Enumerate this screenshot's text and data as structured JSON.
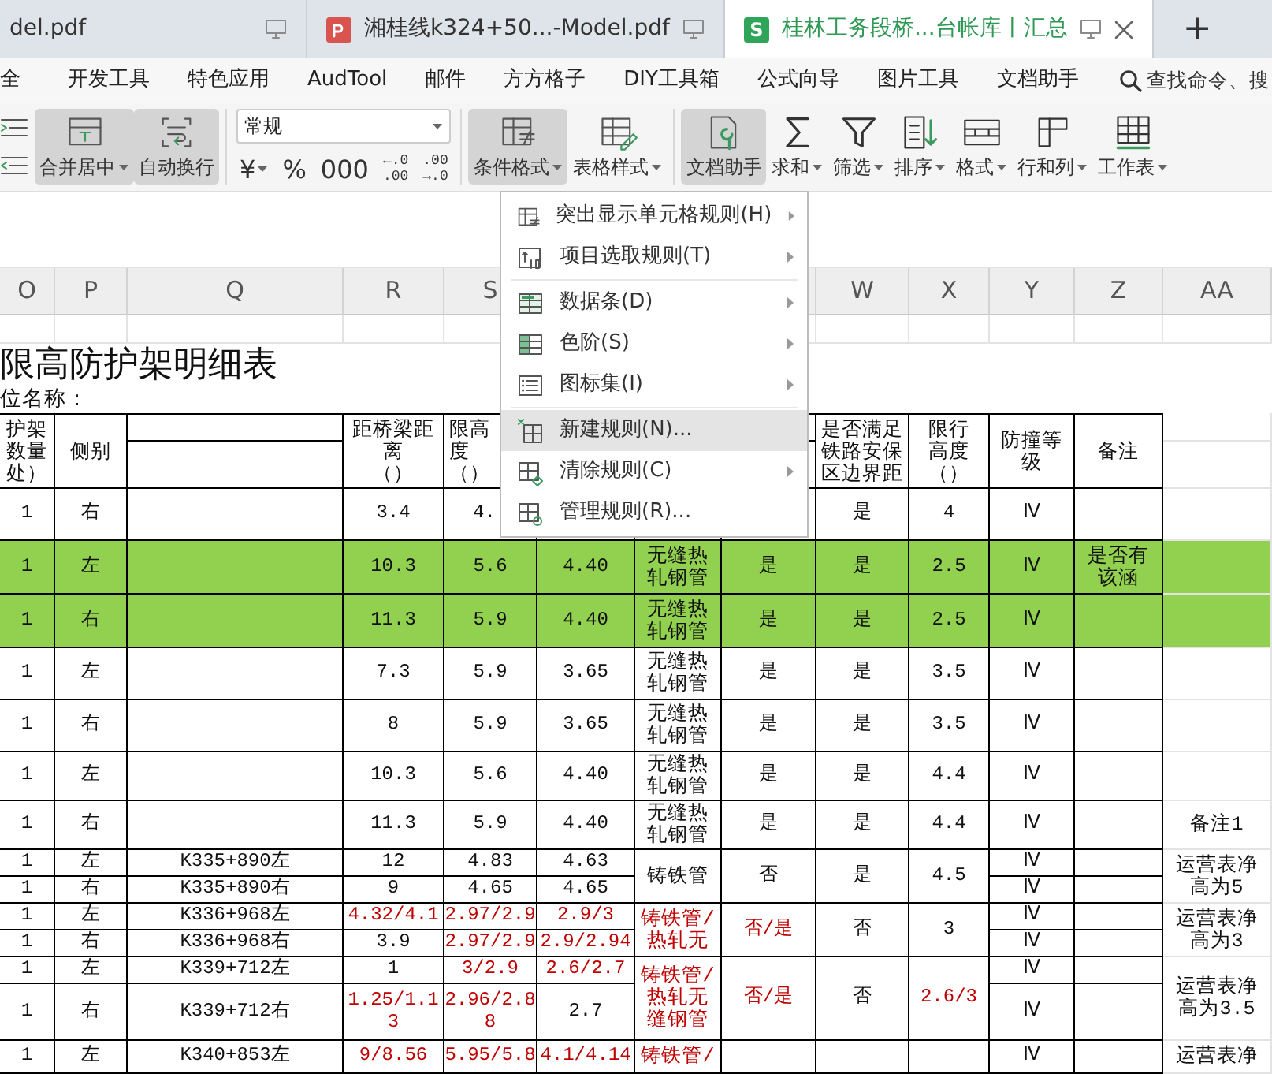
{
  "tabs": [
    {
      "label": "del.pdf",
      "kind": "plain",
      "selected": false
    },
    {
      "label": "湘桂线k324+50...-Model.pdf",
      "kind": "pdf",
      "selected": false
    },
    {
      "label": "桂林工务段桥...台帐库丨汇总",
      "kind": "sheet",
      "logo": "S",
      "selected": true
    }
  ],
  "new_tab": "+",
  "menu_tabs": [
    "全",
    "开发工具",
    "特色应用",
    "AudTool",
    "邮件",
    "方方格子",
    "DIY工具箱",
    "公式向导",
    "图片工具",
    "文档助手"
  ],
  "search": {
    "placeholder": "查找命令、搜"
  },
  "ribbon": [
    {
      "kind": "icon-stack"
    },
    {
      "kind": "big",
      "label": "合并居中",
      "dropdown": true,
      "pressed": true
    },
    {
      "kind": "big",
      "label": "自动换行",
      "dropdown": false,
      "pressed": true
    },
    {
      "kind": "separator"
    },
    {
      "kind": "number-format",
      "value": "常规",
      "symbols": [
        {
          "lines": [
            "¥"
          ],
          "dropdown": true
        },
        {
          "lines": [
            "%"
          ],
          "dropdown": false
        },
        {
          "lines": [
            "000"
          ],
          "dropdown": false
        },
        {
          "lines": [
            "←.0",
            ".00"
          ],
          "dropdown": false
        },
        {
          "lines": [
            ".00",
            "→.0"
          ],
          "dropdown": false
        }
      ]
    },
    {
      "kind": "separator"
    },
    {
      "kind": "big",
      "label": "条件格式",
      "dropdown": true,
      "pressed": true
    },
    {
      "kind": "big",
      "label": "表格样式",
      "dropdown": true,
      "pressed": false
    },
    {
      "kind": "separator"
    },
    {
      "kind": "big",
      "label": "文档助手",
      "dropdown": false,
      "pressed": true
    },
    {
      "kind": "big",
      "label": "求和",
      "dropdown": true,
      "pressed": false
    },
    {
      "kind": "big",
      "label": "筛选",
      "dropdown": true,
      "pressed": false
    },
    {
      "kind": "big",
      "label": "排序",
      "dropdown": true,
      "pressed": false
    },
    {
      "kind": "big",
      "label": "格式",
      "dropdown": true,
      "pressed": false
    },
    {
      "kind": "big",
      "label": "行和列",
      "dropdown": true,
      "pressed": false
    },
    {
      "kind": "big",
      "label": "工作表",
      "dropdown": true,
      "pressed": false
    }
  ],
  "menu": {
    "groups": [
      [
        {
          "label": "突出显示单元格规则(H)",
          "submenu": true,
          "highlighted": false
        },
        {
          "label": "项目选取规则(T)",
          "submenu": true,
          "highlighted": false
        }
      ],
      [
        {
          "label": "数据条(D)",
          "submenu": true,
          "highlighted": false
        },
        {
          "label": "色阶(S)",
          "submenu": true,
          "highlighted": false
        },
        {
          "label": "图标集(I)",
          "submenu": true,
          "highlighted": false
        }
      ],
      [
        {
          "label": "新建规则(N)...",
          "submenu": false,
          "highlighted": true
        },
        {
          "label": "清除规则(C)",
          "submenu": true,
          "highlighted": false
        },
        {
          "label": "管理规则(R)...",
          "submenu": false,
          "highlighted": false
        }
      ]
    ]
  },
  "sheet": {
    "columns": [
      {
        "label": "O"
      },
      {
        "label": "P"
      },
      {
        "label": "Q"
      },
      {
        "label": "R"
      },
      {
        "label": "S"
      },
      {},
      {},
      {},
      {
        "label": "W"
      },
      {
        "label": "X"
      },
      {
        "label": "Y"
      },
      {
        "label": "Z"
      },
      {
        "label": "AA"
      }
    ],
    "rows": [
      {
        "kind": "blank"
      },
      {
        "kind": "title",
        "cells": [
          {
            "text": "限高防护架明细表"
          }
        ]
      },
      {
        "kind": "label",
        "cells": [
          {
            "text": "位名称："
          }
        ]
      },
      {
        "kind": "header",
        "cells": [
          {
            "lines": [
              "护架",
              "数量",
              "处）"
            ],
            "tall": true
          },
          {
            "lines": [
              "侧别"
            ],
            "tall": true
          },
          {},
          {
            "lines": [
              "距桥梁距",
              "离",
              "（）"
            ],
            "tall": true
          },
          {
            "lines": [
              "限高",
              "度",
              "（）"
            ],
            "tall": true
          },
          {},
          {},
          {},
          {
            "lines": [
              "是否满足",
              "铁路安保",
              "区边界距"
            ],
            "tall": true
          },
          {
            "lines": [
              "限行",
              "高度",
              "（）"
            ],
            "tall": true
          },
          {
            "lines": [
              "防撞等",
              "级"
            ],
            "tall": true
          },
          {
            "lines": [
              "备注"
            ],
            "tall": true
          }
        ]
      },
      {
        "kind": "header"
      },
      {
        "kind": "table",
        "highlight": false,
        "cells": [
          {
            "text": "1"
          },
          {
            "text": "右"
          },
          {},
          {
            "text": "3.4"
          },
          {
            "text": "4."
          },
          {},
          {},
          {},
          {
            "text": "是"
          },
          {
            "text": "4"
          },
          {
            "text": "Ⅳ"
          }
        ]
      },
      {
        "kind": "table",
        "highlight": true,
        "cells": [
          {
            "text": "1"
          },
          {
            "text": "左"
          },
          {},
          {
            "text": "10.3"
          },
          {
            "text": "5.6"
          },
          {
            "text": "4.40"
          },
          {
            "lines": [
              "无缝热",
              "轧钢管"
            ]
          },
          {
            "text": "是"
          },
          {
            "text": "是"
          },
          {
            "text": "2.5"
          },
          {
            "text": "Ⅳ"
          },
          {
            "text": "是否有该涵"
          }
        ]
      },
      {
        "kind": "table",
        "highlight": true,
        "cells": [
          {
            "text": "1"
          },
          {
            "text": "右"
          },
          {},
          {
            "text": "11.3"
          },
          {
            "text": "5.9"
          },
          {
            "text": "4.40"
          },
          {
            "lines": [
              "无缝热",
              "轧钢管"
            ]
          },
          {
            "text": "是"
          },
          {
            "text": "是"
          },
          {
            "text": "2.5"
          },
          {
            "text": "Ⅳ"
          }
        ]
      },
      {
        "kind": "table",
        "highlight": false,
        "cells": [
          {
            "text": "1"
          },
          {
            "text": "左"
          },
          {},
          {
            "text": "7.3"
          },
          {
            "text": "5.9"
          },
          {
            "text": "3.65"
          },
          {
            "lines": [
              "无缝热",
              "轧钢管"
            ]
          },
          {
            "text": "是"
          },
          {
            "text": "是"
          },
          {
            "text": "3.5"
          },
          {
            "text": "Ⅳ"
          }
        ]
      },
      {
        "kind": "table",
        "highlight": false,
        "cells": [
          {
            "text": "1"
          },
          {
            "text": "右"
          },
          {},
          {
            "text": "8"
          },
          {
            "text": "5.9"
          },
          {
            "text": "3.65"
          },
          {
            "lines": [
              "无缝热",
              "轧钢管"
            ]
          },
          {
            "text": "是"
          },
          {
            "text": "是"
          },
          {
            "text": "3.5"
          },
          {
            "text": "Ⅳ"
          }
        ]
      },
      {
        "kind": "table",
        "highlight": false,
        "cells": [
          {
            "text": "1"
          },
          {
            "text": "左"
          },
          {},
          {
            "text": "10.3"
          },
          {
            "text": "5.6"
          },
          {
            "text": "4.40"
          },
          {
            "lines": [
              "无缝热",
              "轧钢管"
            ]
          },
          {
            "text": "是"
          },
          {
            "text": "是"
          },
          {
            "text": "4.4"
          },
          {
            "text": "Ⅳ"
          }
        ]
      },
      {
        "kind": "table",
        "highlight": false,
        "cells": [
          {
            "text": "1"
          },
          {
            "text": "右"
          },
          {},
          {
            "text": "11.3"
          },
          {
            "text": "5.9"
          },
          {
            "text": "4.40"
          },
          {
            "lines": [
              "无缝热",
              "轧钢管"
            ]
          },
          {
            "text": "是"
          },
          {
            "text": "是"
          },
          {
            "text": "4.4"
          },
          {
            "text": "Ⅳ"
          },
          {},
          {
            "text": "备注1"
          }
        ]
      },
      {
        "kind": "table",
        "highlight": false,
        "cells": [
          {
            "text": "1"
          },
          {
            "text": "左"
          },
          {
            "text": "K335+890左"
          },
          {
            "text": "12"
          },
          {
            "text": "4.83"
          },
          {
            "text": "4.63"
          },
          {
            "text": "铸铁管",
            "tall": true
          },
          {
            "text": "否",
            "tall": true
          },
          {
            "text": "是",
            "tall": true
          },
          {
            "text": "4.5",
            "tall": true
          },
          {
            "text": "Ⅳ"
          },
          {},
          {
            "text": "运营表净高为5",
            "tall": true
          }
        ]
      },
      {
        "kind": "table",
        "highlight": false,
        "cells": [
          {
            "text": "1"
          },
          {
            "text": "右"
          },
          {
            "text": "K335+890右"
          },
          {
            "text": "9"
          },
          {
            "text": "4.65"
          },
          {
            "text": "4.65"
          },
          {
            "text": "Ⅳ"
          }
        ]
      },
      {
        "kind": "table",
        "highlight": false,
        "cells": [
          {
            "text": "1"
          },
          {
            "text": "左"
          },
          {
            "text": "K336+968左"
          },
          {
            "text": "4.32/4.1",
            "color": "#c00000"
          },
          {
            "text": "2.97/2.9",
            "color": "#c00000"
          },
          {
            "text": "2.9/3",
            "color": "#c00000"
          },
          {
            "lines": [
              "铸铁管/",
              "热轧无"
            ],
            "color": "#c00000",
            "tall": true
          },
          {
            "text": "否/是",
            "color": "#c00000",
            "tall": true
          },
          {
            "text": "否",
            "tall": true
          },
          {
            "text": "3",
            "tall": true
          },
          {
            "text": "Ⅳ"
          },
          {},
          {
            "text": "运营表净高为3",
            "tall": true
          }
        ]
      },
      {
        "kind": "table",
        "highlight": false,
        "cells": [
          {
            "text": "1"
          },
          {
            "text": "右"
          },
          {
            "text": "K336+968右"
          },
          {
            "text": "3.9"
          },
          {
            "text": "2.97/2.9",
            "color": "#c00000"
          },
          {
            "text": "2.9/2.94",
            "color": "#c00000"
          },
          {
            "text": "Ⅳ"
          }
        ]
      },
      {
        "kind": "table",
        "highlight": false,
        "cells": [
          {
            "text": "1"
          },
          {
            "text": "左"
          },
          {
            "text": "K339+712左"
          },
          {
            "text": "1"
          },
          {
            "text": "3/2.9",
            "color": "#c00000"
          },
          {
            "text": "2.6/2.7",
            "color": "#c00000"
          },
          {
            "lines": [
              "铸铁管/",
              "热轧无",
              "缝钢管"
            ],
            "color": "#c00000",
            "tall": true
          },
          {
            "text": "否/是",
            "color": "#c00000",
            "tall": true
          },
          {
            "text": "否",
            "tall": true
          },
          {
            "text": "2.6/3",
            "color": "#c00000",
            "tall": true
          },
          {
            "text": "Ⅳ"
          },
          {},
          {
            "text": "运营表净高为3.5",
            "tall": true
          }
        ]
      },
      {
        "kind": "table",
        "highlight": false,
        "cells": [
          {
            "text": "1"
          },
          {
            "text": "右"
          },
          {
            "text": "K339+712右"
          },
          {
            "text": "1.25/1.13",
            "color": "#c00000"
          },
          {
            "text": "2.96/2.88",
            "color": "#c00000"
          },
          {
            "text": "2.7"
          },
          {
            "text": "Ⅳ"
          }
        ]
      },
      {
        "kind": "table",
        "highlight": false,
        "cells": [
          {
            "text": "1"
          },
          {
            "text": "左"
          },
          {
            "text": "K340+853左"
          },
          {
            "text": "9/8.56",
            "color": "#c00000"
          },
          {
            "text": "5.95/5.8",
            "color": "#c00000"
          },
          {
            "text": "4.1/4.14",
            "color": "#c00000"
          },
          {
            "text": "铸铁管/",
            "color": "#c00000"
          },
          {},
          {},
          {},
          {
            "text": "Ⅳ"
          },
          {},
          {
            "text": "运营表净"
          }
        ]
      }
    ]
  }
}
